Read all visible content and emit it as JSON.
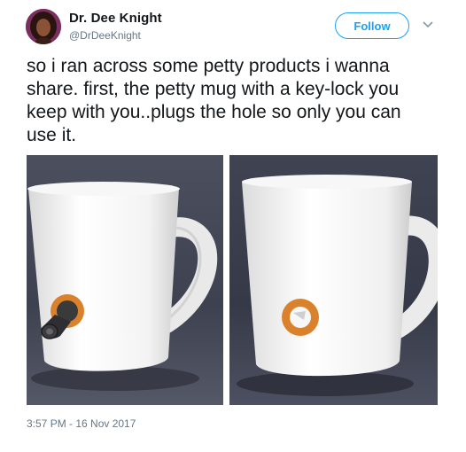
{
  "author": {
    "name": "Dr. Dee Knight",
    "handle": "@DrDeeKnight"
  },
  "actions": {
    "follow_label": "Follow",
    "more_icon": "chevron-down-icon"
  },
  "tweet": {
    "text": "so i ran across some petty products i wanna\nshare. first, the petty mug with a key-lock you\nkeep with you..plugs the hole so only you can\nuse it.",
    "timestamp": "3:57 PM - 16 Nov 2017"
  },
  "colors": {
    "accent": "#1da1f2",
    "text": "#14171a",
    "muted": "#657786",
    "lock_orange": "#d9822b"
  }
}
